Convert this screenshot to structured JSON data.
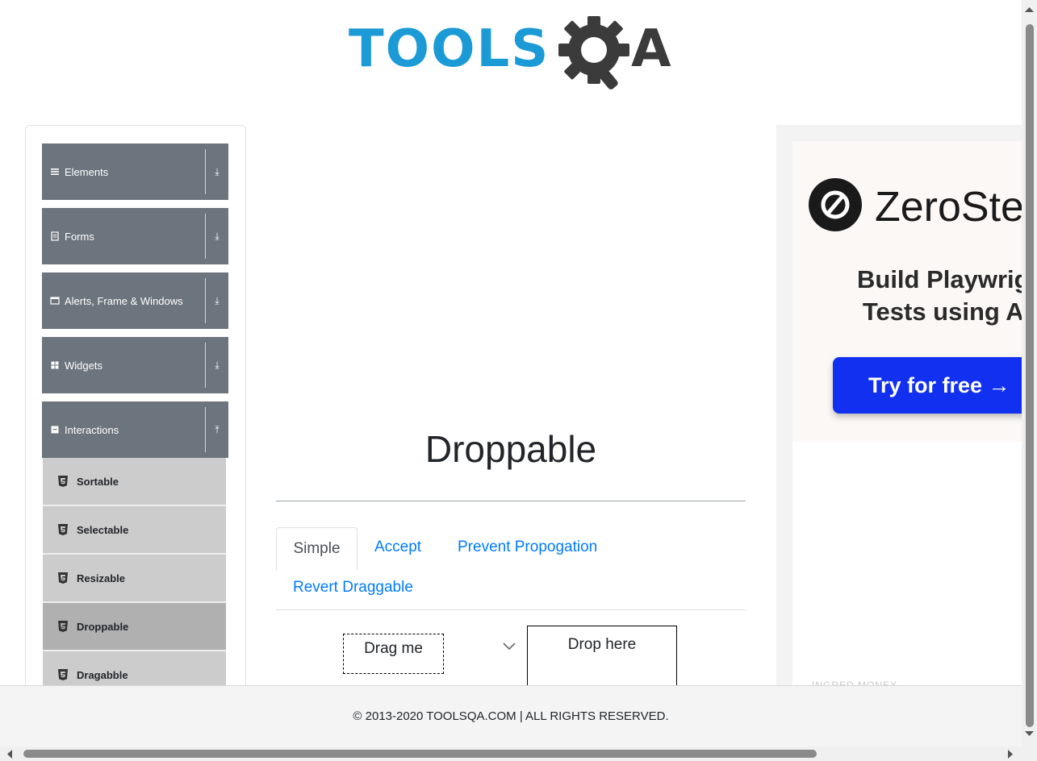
{
  "logo": {
    "text_left": "TOOLS",
    "text_right": "A"
  },
  "sidebar": {
    "groups": [
      {
        "label": "Elements",
        "icon": "hamburger-icon",
        "arrow": "⤓"
      },
      {
        "label": "Forms",
        "icon": "form-icon",
        "arrow": "⤓"
      },
      {
        "label": "Alerts, Frame & Windows",
        "icon": "window-icon",
        "arrow": "⤓"
      },
      {
        "label": "Widgets",
        "icon": "grid-icon",
        "arrow": "⤓"
      },
      {
        "label": "Interactions",
        "icon": "interactions-icon",
        "arrow": "⤒"
      }
    ],
    "items": [
      {
        "label": "Sortable"
      },
      {
        "label": "Selectable"
      },
      {
        "label": "Resizable"
      },
      {
        "label": "Droppable"
      },
      {
        "label": "Dragabble"
      }
    ]
  },
  "main": {
    "title": "Droppable",
    "tabs": [
      "Simple",
      "Accept",
      "Prevent Propogation",
      "Revert Draggable"
    ],
    "drag_label": "Drag me",
    "drop_label": "Drop here"
  },
  "ad": {
    "brand": "ZeroSte",
    "headline_line1": "Build Playwrig",
    "headline_line2": "Tests using A",
    "cta": "Try for free →",
    "footer_text": "INGRED MONEY"
  },
  "footer": {
    "text": "© 2013-2020 TOOLSQA.COM | ALL RIGHTS RESERVED."
  },
  "colors": {
    "brand_blue": "#1b9ad6",
    "sidebar_header": "#6c757d",
    "menu_item": "#cccccc",
    "menu_item_active": "#b0b0b0",
    "link": "#007bff",
    "ad_cta": "#1230f0"
  }
}
